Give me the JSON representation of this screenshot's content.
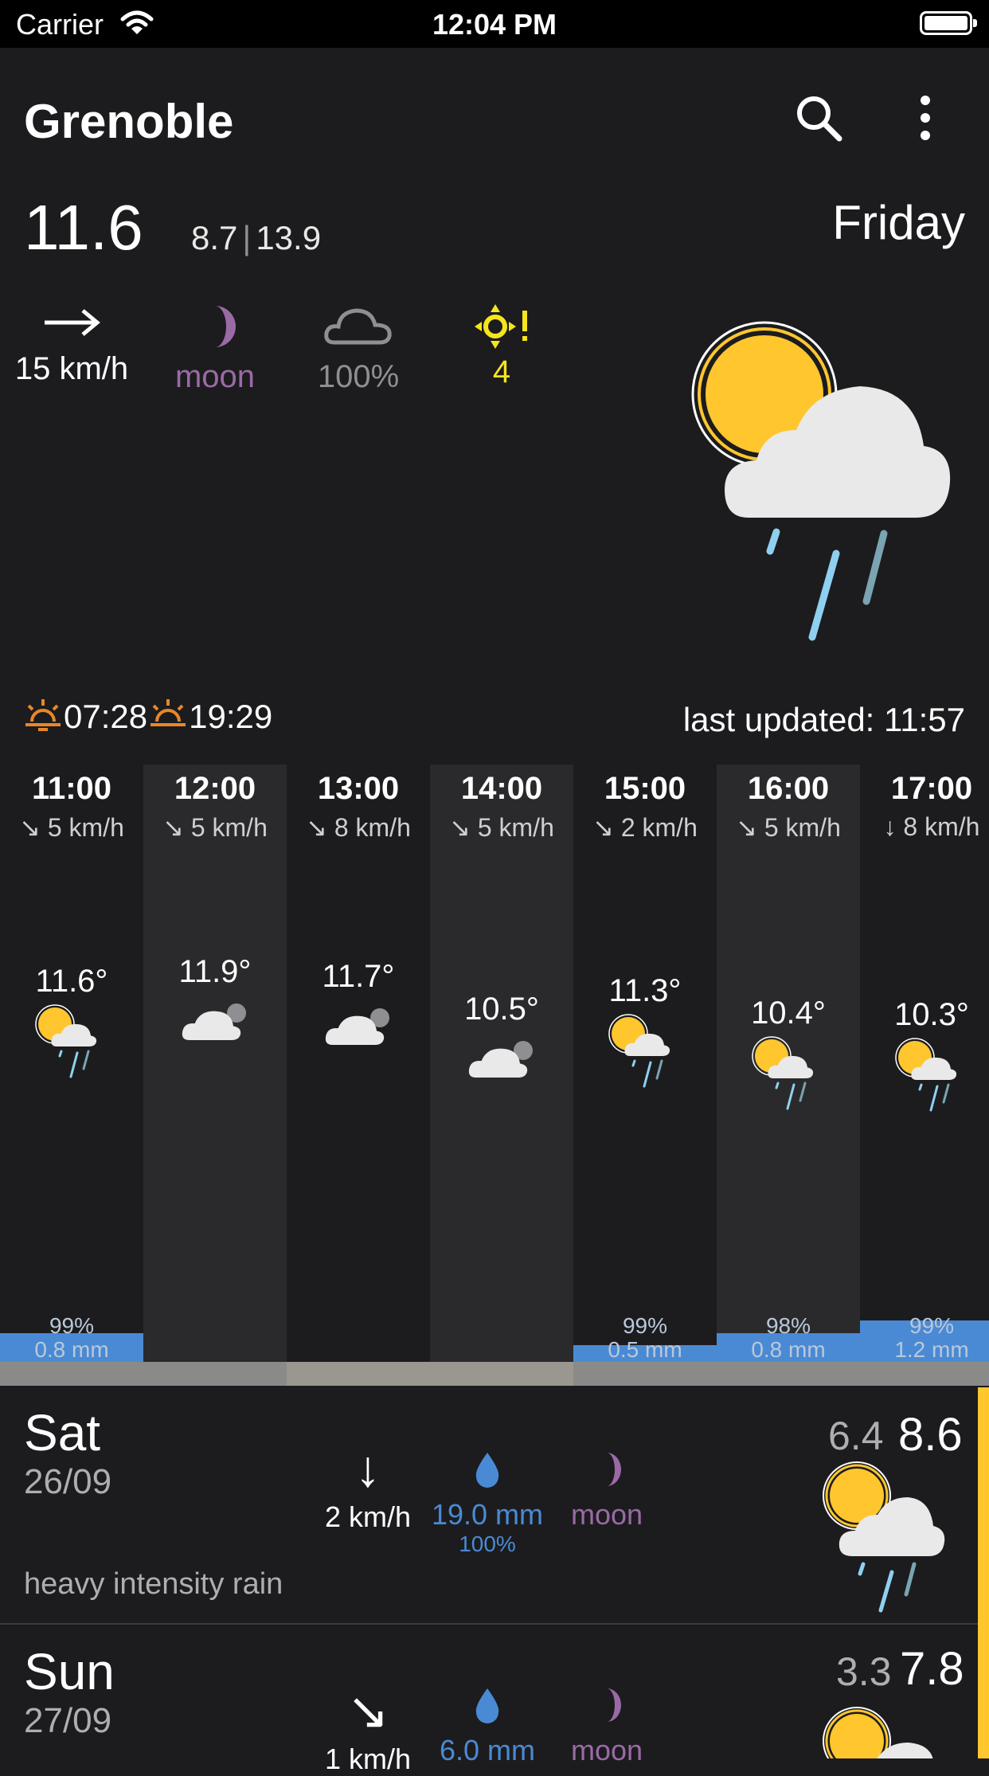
{
  "status_bar": {
    "carrier": "Carrier",
    "time": "12:04 PM"
  },
  "header": {
    "city": "Grenoble",
    "search_icon": "search-icon",
    "menu_icon": "more-vertical-icon"
  },
  "current": {
    "temp": "11.6",
    "min": "8.7",
    "separator": "|",
    "max": "13.9",
    "day": "Friday",
    "wind": "15 km/h",
    "moon": "moon",
    "cloud": "100%",
    "uv": "4",
    "icon": "sun-cloud-rain-icon",
    "sunrise": "07:28",
    "sunset": "19:29",
    "last_updated": "last updated: 11:57"
  },
  "colors": {
    "background": "#1c1c1e",
    "sun": "#ffc62e",
    "moon": "#9a6aa6",
    "rain": "#4a8ad4",
    "uv": "#f5e51c",
    "accent": "#ffc62e"
  },
  "hourly": [
    {
      "hour": "11:00",
      "wind": "↘ 5 km/h",
      "temp": "11.6°",
      "icon": "sun-cloud-rain-icon",
      "chance": "99%",
      "rain": "0.8 mm",
      "rain_fraction": 0.07
    },
    {
      "hour": "12:00",
      "wind": "↘ 5 km/h",
      "temp": "11.9°",
      "icon": "cloud-icon",
      "chance": "",
      "rain": "",
      "rain_fraction": 0
    },
    {
      "hour": "13:00",
      "wind": "↘ 8 km/h",
      "temp": "11.7°",
      "icon": "cloud-icon",
      "chance": "",
      "rain": "",
      "rain_fraction": 0
    },
    {
      "hour": "14:00",
      "wind": "↘ 5 km/h",
      "temp": "10.5°",
      "icon": "cloud-icon",
      "chance": "",
      "rain": "",
      "rain_fraction": 0
    },
    {
      "hour": "15:00",
      "wind": "↘ 2 km/h",
      "temp": "11.3°",
      "icon": "sun-cloud-rain-icon",
      "chance": "99%",
      "rain": "0.5 mm",
      "rain_fraction": 0.04
    },
    {
      "hour": "16:00",
      "wind": "↘ 5 km/h",
      "temp": "10.4°",
      "icon": "sun-cloud-rain-icon",
      "chance": "98%",
      "rain": "0.8 mm",
      "rain_fraction": 0.07
    },
    {
      "hour": "17:00",
      "wind": "↓ 8 km/h",
      "temp": "10.3°",
      "icon": "sun-cloud-rain-icon",
      "chance": "99%",
      "rain": "1.2 mm",
      "rain_fraction": 0.1
    }
  ],
  "daily": [
    {
      "day": "Sat",
      "date": "26/09",
      "desc": "heavy intensity rain",
      "wind_arrow": "↓",
      "wind": "2 km/h",
      "rain": "19.0 mm",
      "chance": "100%",
      "moon": "moon",
      "min": "6.4",
      "max": "8.6",
      "icon": "sun-cloud-rain-icon"
    },
    {
      "day": "Sun",
      "date": "27/09",
      "desc": "",
      "wind_arrow": "↘",
      "wind": "1 km/h",
      "rain": "6.0 mm",
      "chance": "",
      "moon": "moon",
      "min": "3.3",
      "max": "7.8",
      "icon": "sun-cloud-icon"
    }
  ]
}
